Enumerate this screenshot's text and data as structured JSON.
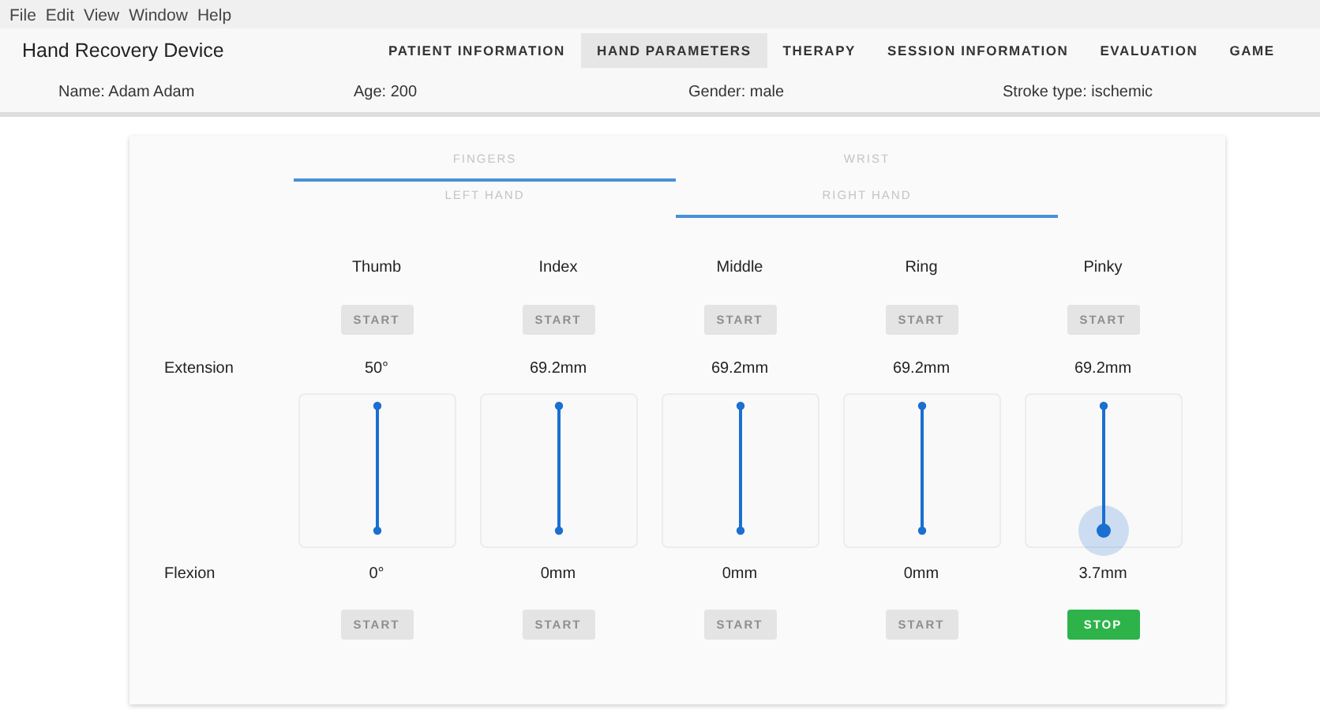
{
  "menu": [
    "File",
    "Edit",
    "View",
    "Window",
    "Help"
  ],
  "app_title": "Hand Recovery Device",
  "nav_tabs": [
    {
      "label": "PATIENT INFORMATION",
      "selected": false
    },
    {
      "label": "HAND PARAMETERS",
      "selected": true
    },
    {
      "label": "THERAPY",
      "selected": false
    },
    {
      "label": "SESSION INFORMATION",
      "selected": false
    },
    {
      "label": "EVALUATION",
      "selected": false
    },
    {
      "label": "GAME",
      "selected": false
    }
  ],
  "patient": [
    "Name: Adam Adam",
    "Age: 200",
    "Gender: male",
    "Stroke type: ischemic"
  ],
  "part_tabs": [
    {
      "label": "FINGERS",
      "selected": true
    },
    {
      "label": "WRIST",
      "selected": false
    }
  ],
  "hand_tabs": [
    {
      "label": "LEFT HAND",
      "selected": false
    },
    {
      "label": "RIGHT HAND",
      "selected": true
    }
  ],
  "row_labels": {
    "extension": "Extension",
    "flexion": "Flexion"
  },
  "fingers": [
    {
      "name": "Thumb",
      "extension": "50°",
      "flexion": "0°",
      "active": false,
      "top_button": {
        "label": "START",
        "kind": "start",
        "disabled": true
      },
      "bottom_button": {
        "label": "START",
        "kind": "start",
        "disabled": true
      }
    },
    {
      "name": "Index",
      "extension": "69.2mm",
      "flexion": "0mm",
      "active": false,
      "top_button": {
        "label": "START",
        "kind": "start",
        "disabled": true
      },
      "bottom_button": {
        "label": "START",
        "kind": "start",
        "disabled": true
      }
    },
    {
      "name": "Middle",
      "extension": "69.2mm",
      "flexion": "0mm",
      "active": false,
      "top_button": {
        "label": "START",
        "kind": "start",
        "disabled": true
      },
      "bottom_button": {
        "label": "START",
        "kind": "start",
        "disabled": true
      }
    },
    {
      "name": "Ring",
      "extension": "69.2mm",
      "flexion": "0mm",
      "active": false,
      "top_button": {
        "label": "START",
        "kind": "start",
        "disabled": true
      },
      "bottom_button": {
        "label": "START",
        "kind": "start",
        "disabled": true
      }
    },
    {
      "name": "Pinky",
      "extension": "69.2mm",
      "flexion": "3.7mm",
      "active": true,
      "top_button": {
        "label": "START",
        "kind": "start",
        "disabled": true
      },
      "bottom_button": {
        "label": "STOP",
        "kind": "stop",
        "disabled": false
      }
    }
  ]
}
